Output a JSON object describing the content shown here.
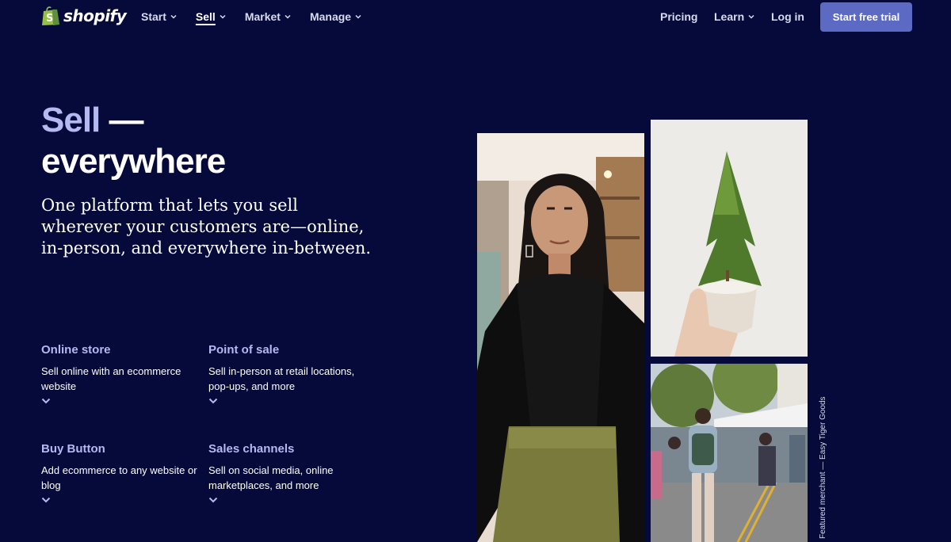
{
  "nav": {
    "brand": "shopify",
    "items": [
      {
        "label": "Start"
      },
      {
        "label": "Sell"
      },
      {
        "label": "Market"
      },
      {
        "label": "Manage"
      }
    ],
    "pricing": "Pricing",
    "learn": "Learn",
    "login": "Log in",
    "cta": "Start free trial"
  },
  "hero": {
    "title_accent": "Sell",
    "title_dash": " —",
    "title_rest": "everywhere",
    "subtitle": "One platform that lets you sell wherever your customers are—online, in-person, and everywhere in-between."
  },
  "features": [
    {
      "title": "Online store",
      "desc": "Sell online with an ecommerce website"
    },
    {
      "title": "Point of sale",
      "desc": "Sell in-person at retail locations, pop-ups, and more"
    },
    {
      "title": "Buy Button",
      "desc": "Add ecommerce to any website or blog"
    },
    {
      "title": "Sales channels",
      "desc": "Sell on social media, online marketplaces, and more"
    }
  ],
  "credit": "Featured merchant — Easy Tiger Goods",
  "colors": {
    "background": "#050a3a",
    "accent": "#b4b9f2",
    "cta": "#5c6ac4"
  }
}
